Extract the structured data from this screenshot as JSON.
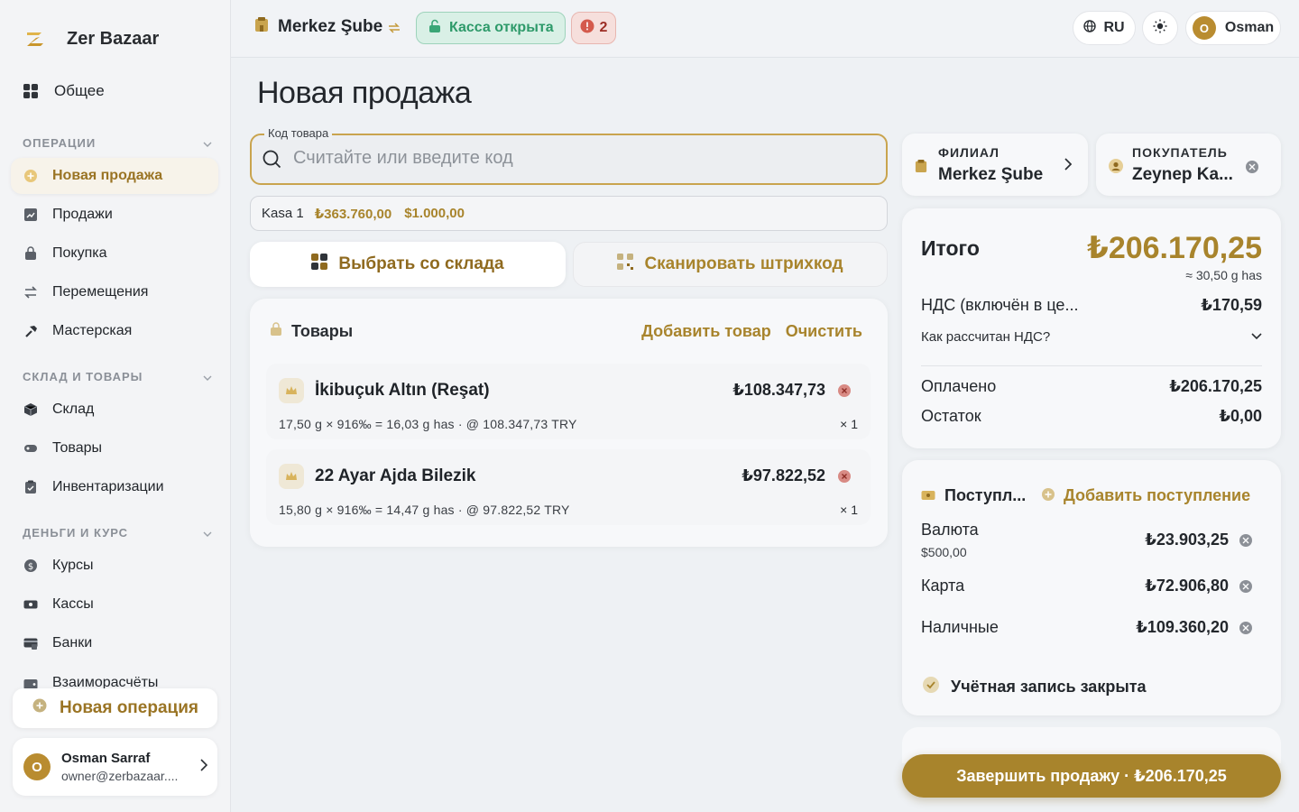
{
  "app": {
    "name": "Zer Bazaar"
  },
  "sidebar": {
    "top_item": "Общее",
    "sections": [
      {
        "title": "ОПЕРАЦИИ",
        "items": [
          "Новая продажа",
          "Продажи",
          "Покупка",
          "Перемещения",
          "Мастерская"
        ]
      },
      {
        "title": "СКЛАД И ТОВАРЫ",
        "items": [
          "Склад",
          "Товары",
          "Инвентаризации"
        ]
      },
      {
        "title": "ДЕНЬГИ И КУРС",
        "items": [
          "Курсы",
          "Кассы",
          "Банки",
          "Взаиморасчёты"
        ]
      }
    ],
    "active_item": "Новая продажа",
    "new_operation_label": "Новая операция",
    "user": {
      "initial": "O",
      "name": "Osman Sarraf",
      "email": "owner@zerbazaar...."
    }
  },
  "topbar": {
    "branch": "Merkez Şube",
    "kassa_status": "Касса открыта",
    "alerts_count": "2",
    "language": "RU",
    "user_initial": "O",
    "user_name": "Osman"
  },
  "page": {
    "title": "Новая продажа",
    "search": {
      "label": "Код товара",
      "placeholder": "Считайте или введите код",
      "value": ""
    },
    "kasa": {
      "name": "Kasa 1",
      "balance_try": "₺363.760,00",
      "balance_usd": "$1.000,00"
    },
    "actions": {
      "from_stock": "Выбрать со склада",
      "scan_barcode": "Сканировать штрихкод"
    },
    "goods": {
      "title": "Товары",
      "add_label": "Добавить товар",
      "clear_label": "Очистить",
      "items": [
        {
          "name": "İkibuçuk Altın (Reşat)",
          "price": "₺108.347,73",
          "desc": "17,50 g × 916‰ = 16,03 g has · @ 108.347,73 TRY",
          "qty": "× 1"
        },
        {
          "name": "22 Ayar Ajda Bilezik",
          "price": "₺97.822,52",
          "desc": "15,80 g × 916‰ = 14,47 g has · @ 97.822,52 TRY",
          "qty": "× 1"
        }
      ]
    }
  },
  "right": {
    "branch": {
      "label": "ФИЛИАЛ",
      "value": "Merkez Şube"
    },
    "customer": {
      "label": "ПОКУПАТЕЛЬ",
      "value": "Zeynep Ka..."
    },
    "summary": {
      "total_label": "Итого",
      "total_value": "₺206.170,25",
      "has_equiv": "≈ 30,50 g has",
      "vat_label": "НДС (включён в це...",
      "vat_value": "₺170,59",
      "vat_how": "Как рассчитан НДС?",
      "paid_label": "Оплачено",
      "paid_value": "₺206.170,25",
      "rest_label": "Остаток",
      "rest_value": "₺0,00"
    },
    "payments": {
      "title": "Поступл...",
      "add_label": "Добавить поступление",
      "rows": [
        {
          "name": "Валюта",
          "sub": "$500,00",
          "value": "₺23.903,25"
        },
        {
          "name": "Карта",
          "value": "₺72.906,80"
        },
        {
          "name": "Наличные",
          "value": "₺109.360,20"
        }
      ],
      "account_closed": "Учётная запись закрыта"
    },
    "finish_label": "Завершить продажу · ₺206.170,25"
  },
  "colors": {
    "accent": "#a8842c",
    "success": "#2e9a6a",
    "danger": "#9c2d24"
  }
}
